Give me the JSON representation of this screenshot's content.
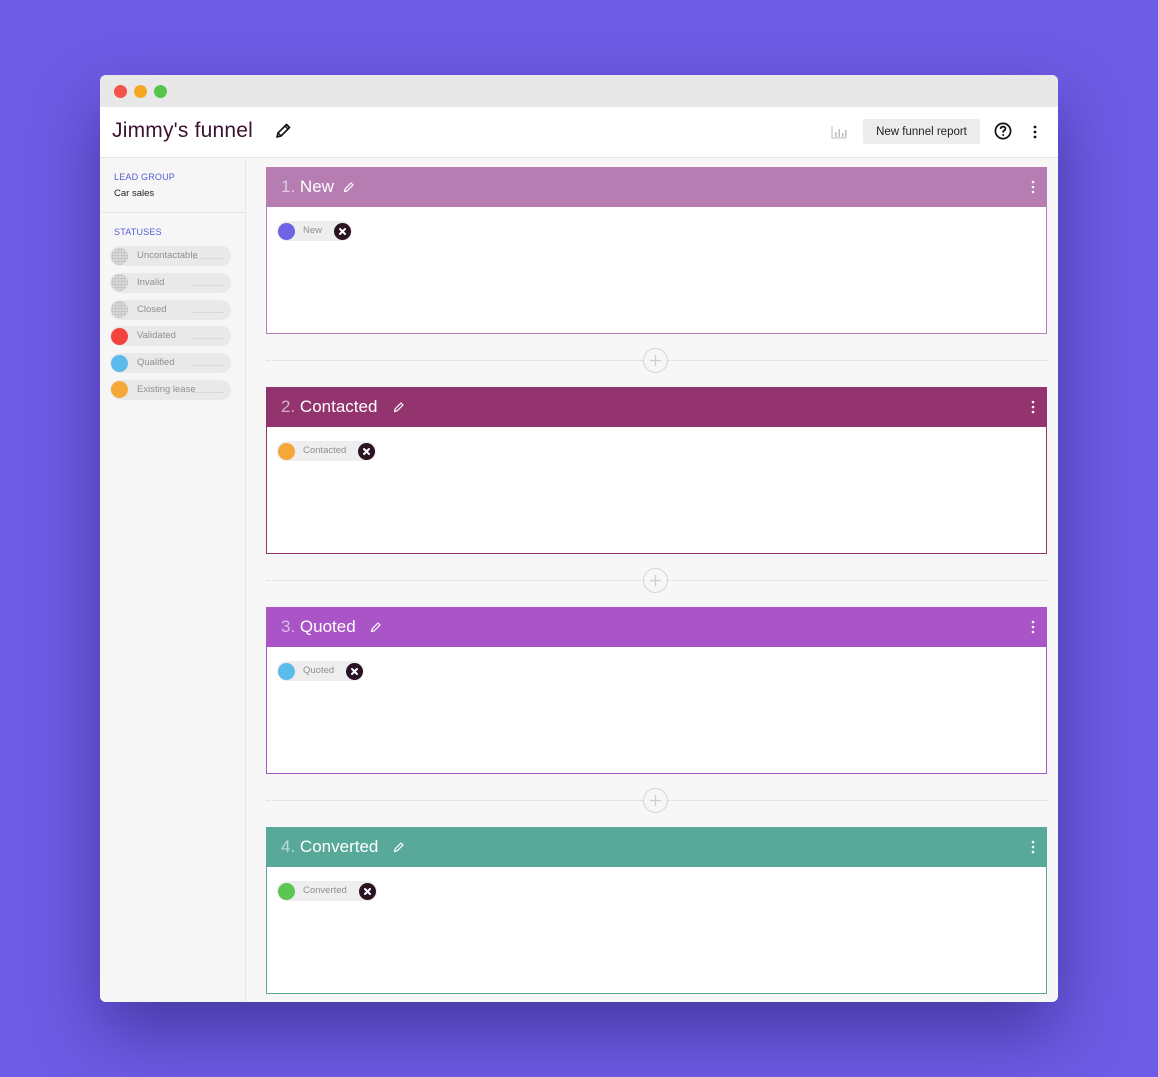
{
  "header": {
    "title": "Jimmy's funnel",
    "report_button": "New funnel report"
  },
  "sidebar": {
    "lead_group_label": "LEAD GROUP",
    "lead_group_value": "Car sales",
    "statuses_label": "STATUSES",
    "statuses": [
      {
        "label": "Uncontactable",
        "color": null
      },
      {
        "label": "Invalid",
        "color": null
      },
      {
        "label": "Closed",
        "color": null
      },
      {
        "label": "Validated",
        "color": "#f4433f"
      },
      {
        "label": "Qualified",
        "color": "#5bbbea"
      },
      {
        "label": "Existing lease",
        "color": "#f5a83a"
      }
    ]
  },
  "stages": [
    {
      "number": "1.",
      "name": "New",
      "color": "#b57db1",
      "chip": {
        "label": "New",
        "color": "#7063e6"
      }
    },
    {
      "number": "2.",
      "name": "Contacted",
      "color": "#94346f",
      "chip": {
        "label": "Contacted",
        "color": "#f5a83a"
      }
    },
    {
      "number": "3.",
      "name": "Quoted",
      "color": "#a955c7",
      "chip": {
        "label": "Quoted",
        "color": "#5bbbea"
      }
    },
    {
      "number": "4.",
      "name": "Converted",
      "color": "#58a999",
      "chip": {
        "label": "Converted",
        "color": "#5cc653"
      }
    }
  ],
  "icons": [
    "pencil-icon",
    "bar-chart-icon",
    "help-circle-icon",
    "more-vertical-icon",
    "close-circle-icon",
    "plus-circle-icon"
  ]
}
